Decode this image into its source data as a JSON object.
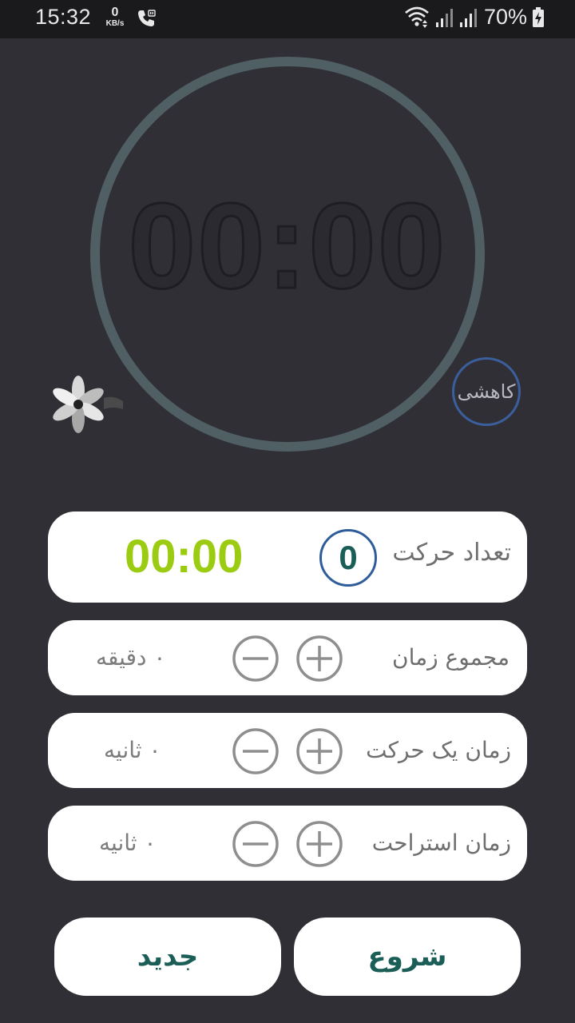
{
  "status_bar": {
    "time": "15:32",
    "net_speed_value": "0",
    "net_speed_unit": "KB/s",
    "battery_percent": "70%",
    "icons": [
      "call-icon",
      "wifi-icon",
      "signal-icon",
      "signal-icon",
      "battery-charging-icon"
    ]
  },
  "timer": {
    "display": "00:00",
    "ring_color": "#4f5f63"
  },
  "mode_button": {
    "label": "کاهشی"
  },
  "count_card": {
    "label": "تعداد حرکت",
    "count": "0",
    "elapsed": "00:00",
    "elapsed_color": "#9ccc12"
  },
  "settings": [
    {
      "label": "مجموع زمان",
      "value": "۰ دقیقه"
    },
    {
      "label": "زمان یک حرکت",
      "value": "۰ ثانیه"
    },
    {
      "label": "زمان استراحت",
      "value": "۰ ثانیه"
    }
  ],
  "buttons": {
    "start": "شروع",
    "new": "جدید"
  },
  "colors": {
    "background": "#302f36",
    "accent_text": "#1b5e57",
    "card": "#ffffff"
  }
}
